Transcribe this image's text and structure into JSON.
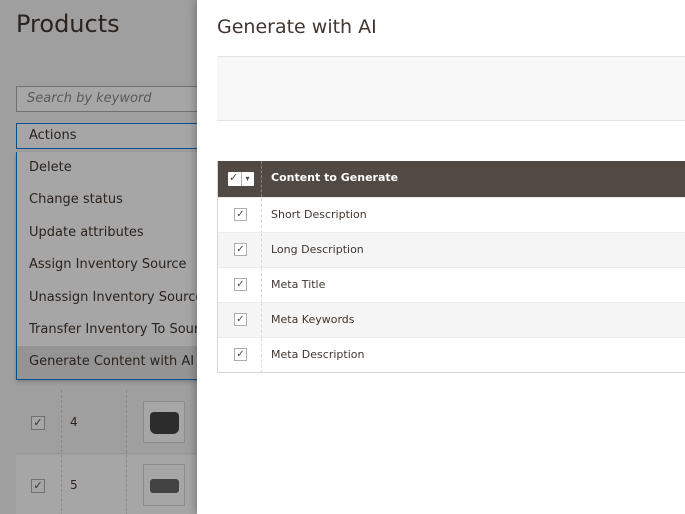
{
  "page": {
    "title": "Products",
    "search_placeholder": "Search by keyword",
    "actions_label": "Actions",
    "actions_menu": [
      "Delete",
      "Change status",
      "Update attributes",
      "Assign Inventory Source",
      "Unassign Inventory Source",
      "Transfer Inventory To Source",
      "Generate Content with AI"
    ],
    "selected_action": "Generate Content with AI",
    "grid_rows": [
      {
        "id": "4",
        "checked": true,
        "check_glyph": "✓"
      },
      {
        "id": "5",
        "checked": true,
        "check_glyph": "✓"
      }
    ]
  },
  "modal": {
    "title": "Generate with AI",
    "table": {
      "header": "Content to Generate",
      "mass_check_glyph": "✓",
      "mass_arrow_glyph": "▾",
      "rows": [
        {
          "label": "Short Description",
          "checked": true,
          "check_glyph": "✓"
        },
        {
          "label": "Long Description",
          "checked": true,
          "check_glyph": "✓"
        },
        {
          "label": "Meta Title",
          "checked": true,
          "check_glyph": "✓"
        },
        {
          "label": "Meta Keywords",
          "checked": true,
          "check_glyph": "✓"
        },
        {
          "label": "Meta Description",
          "checked": true,
          "check_glyph": "✓"
        }
      ]
    }
  },
  "colors": {
    "header_bg": "#514943",
    "accent_border": "#007bdb",
    "text": "#41362f"
  },
  "icons": {
    "checkbox": "checkmark-icon",
    "dropdown": "chevron-down-icon"
  }
}
